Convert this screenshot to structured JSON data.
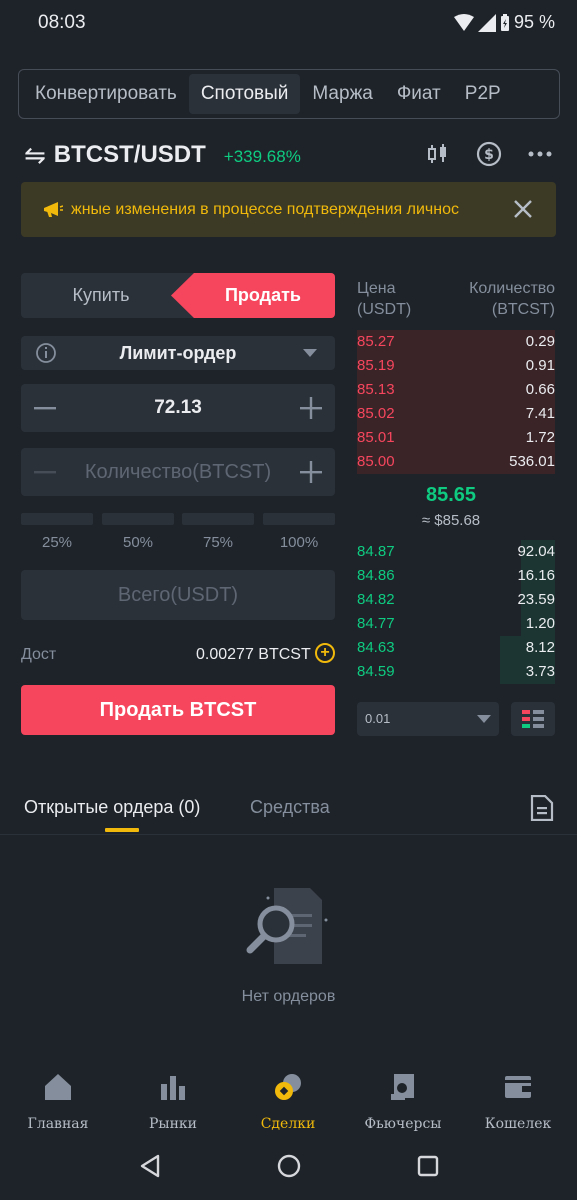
{
  "status_bar": {
    "time": "08:03",
    "battery": "95 %"
  },
  "top_tabs": [
    {
      "label": "Конвертировать",
      "active": false
    },
    {
      "label": "Спотовый",
      "active": true
    },
    {
      "label": "Маржа",
      "active": false
    },
    {
      "label": "Фиат",
      "active": false
    },
    {
      "label": "P2P",
      "active": false
    }
  ],
  "pair": {
    "symbol": "BTCST/USDT",
    "change": "+339.68%"
  },
  "header_icons": [
    "candlestick-chart-icon",
    "dollar-circle-icon",
    "more-horizontal-icon"
  ],
  "banner": {
    "text": "жные изменения в процессе подтверждения личнос",
    "icon": "megaphone-icon"
  },
  "order_form": {
    "buy_label": "Купить",
    "sell_label": "Продать",
    "order_type": "Лимит-ордер",
    "price": "72.13",
    "quantity_placeholder": "Количество(BTCST)",
    "percentages": [
      "25%",
      "50%",
      "75%",
      "100%"
    ],
    "total_placeholder": "Всего(USDT)",
    "available_label": "Дост",
    "available_value": "0.00277 BTCST",
    "submit_label": "Продать BTCST"
  },
  "order_book": {
    "price_header": [
      "Цена",
      "(USDT)"
    ],
    "qty_header": [
      "Количество",
      "(BTCST)"
    ],
    "asks": [
      {
        "price": "85.27",
        "qty": "0.29",
        "depth": 1.0
      },
      {
        "price": "85.19",
        "qty": "0.91",
        "depth": 1.0
      },
      {
        "price": "85.13",
        "qty": "0.66",
        "depth": 1.0
      },
      {
        "price": "85.02",
        "qty": "7.41",
        "depth": 1.0
      },
      {
        "price": "85.01",
        "qty": "1.72",
        "depth": 1.0
      },
      {
        "price": "85.00",
        "qty": "536.01",
        "depth": 1.0
      }
    ],
    "last_price": "85.65",
    "last_price_fiat": "≈ $85.68",
    "bids": [
      {
        "price": "84.87",
        "qty": "92.04",
        "depth": 0.17
      },
      {
        "price": "84.86",
        "qty": "16.16",
        "depth": 0.17
      },
      {
        "price": "84.82",
        "qty": "23.59",
        "depth": 0.17
      },
      {
        "price": "84.77",
        "qty": "1.20",
        "depth": 0.17
      },
      {
        "price": "84.63",
        "qty": "8.12",
        "depth": 0.28
      },
      {
        "price": "84.59",
        "qty": "3.73",
        "depth": 0.28
      }
    ],
    "depth_step": "0.01"
  },
  "bottom_tabs": {
    "open_orders": "Открытые ордера (0)",
    "funds": "Средства"
  },
  "empty_state": "Нет ордеров",
  "nav": [
    {
      "label": "Главная",
      "icon": "home-icon",
      "active": false
    },
    {
      "label": "Рынки",
      "icon": "markets-icon",
      "active": false
    },
    {
      "label": "Сделки",
      "icon": "trades-icon",
      "active": true
    },
    {
      "label": "Фьючерсы",
      "icon": "futures-icon",
      "active": false
    },
    {
      "label": "Кошелек",
      "icon": "wallet-icon",
      "active": false
    }
  ],
  "colors": {
    "background": "#1e2329",
    "sell": "#f6465d",
    "buy": "#0ecb81",
    "accent": "#f0b90b"
  }
}
